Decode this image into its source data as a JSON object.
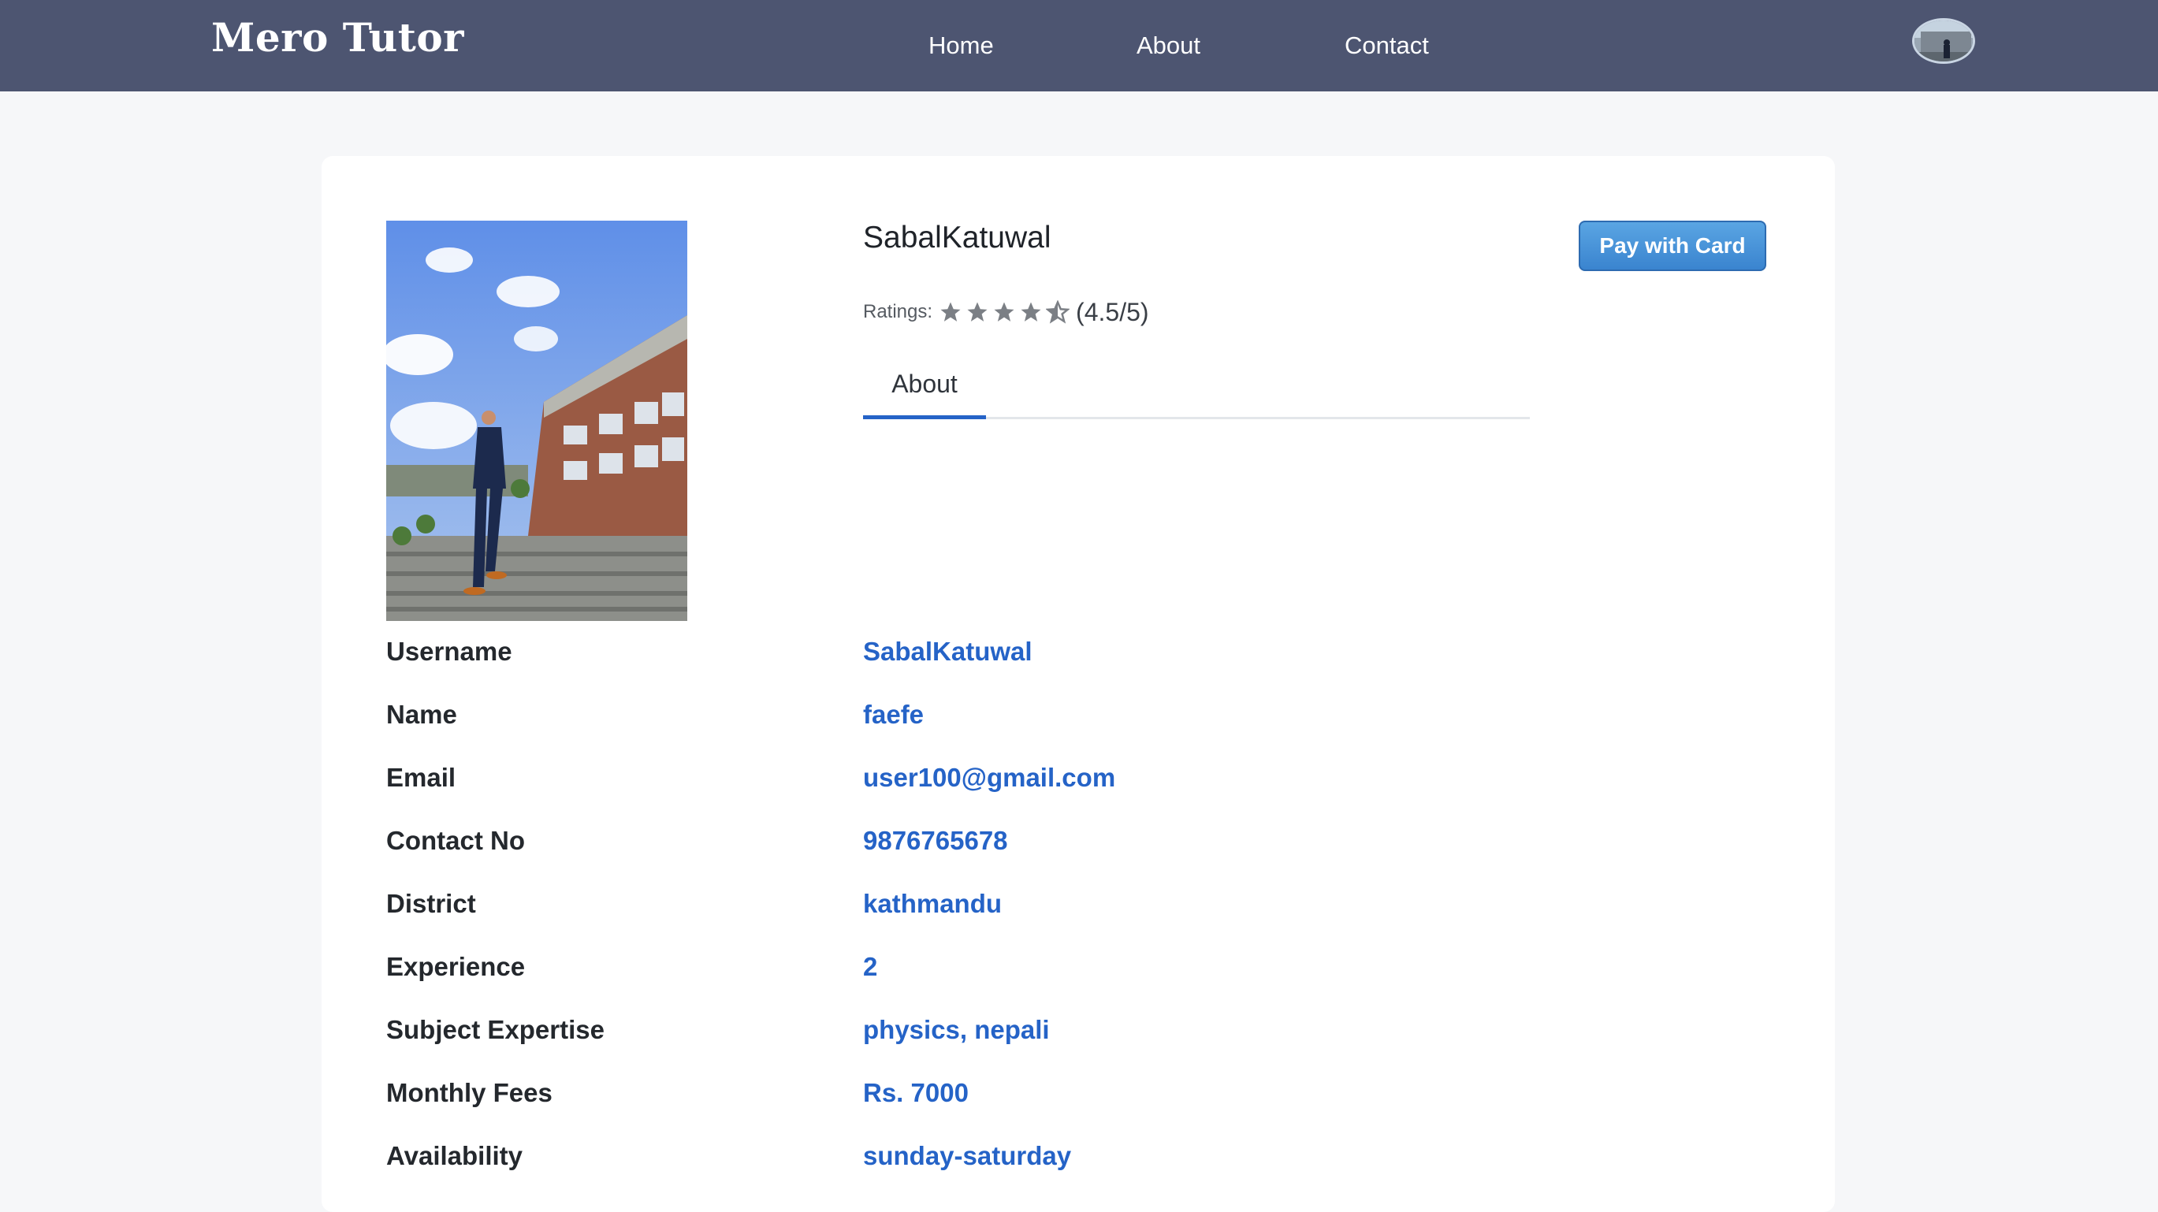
{
  "nav": {
    "brand": "Mero Tutor",
    "links": [
      "Home",
      "About",
      "Contact"
    ]
  },
  "profile": {
    "username": "SabalKatuwal",
    "ratings_label": "Ratings:",
    "rating_stars": 4.5,
    "rating_text": "(4.5/5)",
    "pay_button": "Pay with Card",
    "tabs": [
      "About"
    ]
  },
  "details": [
    {
      "label": "Username",
      "value": "SabalKatuwal"
    },
    {
      "label": "Name",
      "value": "faefe"
    },
    {
      "label": "Email",
      "value": "user100@gmail.com"
    },
    {
      "label": "Contact No",
      "value": "9876765678"
    },
    {
      "label": "District",
      "value": "kathmandu"
    },
    {
      "label": "Experience",
      "value": "2"
    },
    {
      "label": "Subject Expertise",
      "value": "physics, nepali"
    },
    {
      "label": "Monthly Fees",
      "value": "Rs. 7000"
    },
    {
      "label": "Availability",
      "value": "sunday-saturday"
    }
  ],
  "colors": {
    "navbar": "#4d5571",
    "accent": "#2563c7",
    "star": "#7b7f85"
  }
}
